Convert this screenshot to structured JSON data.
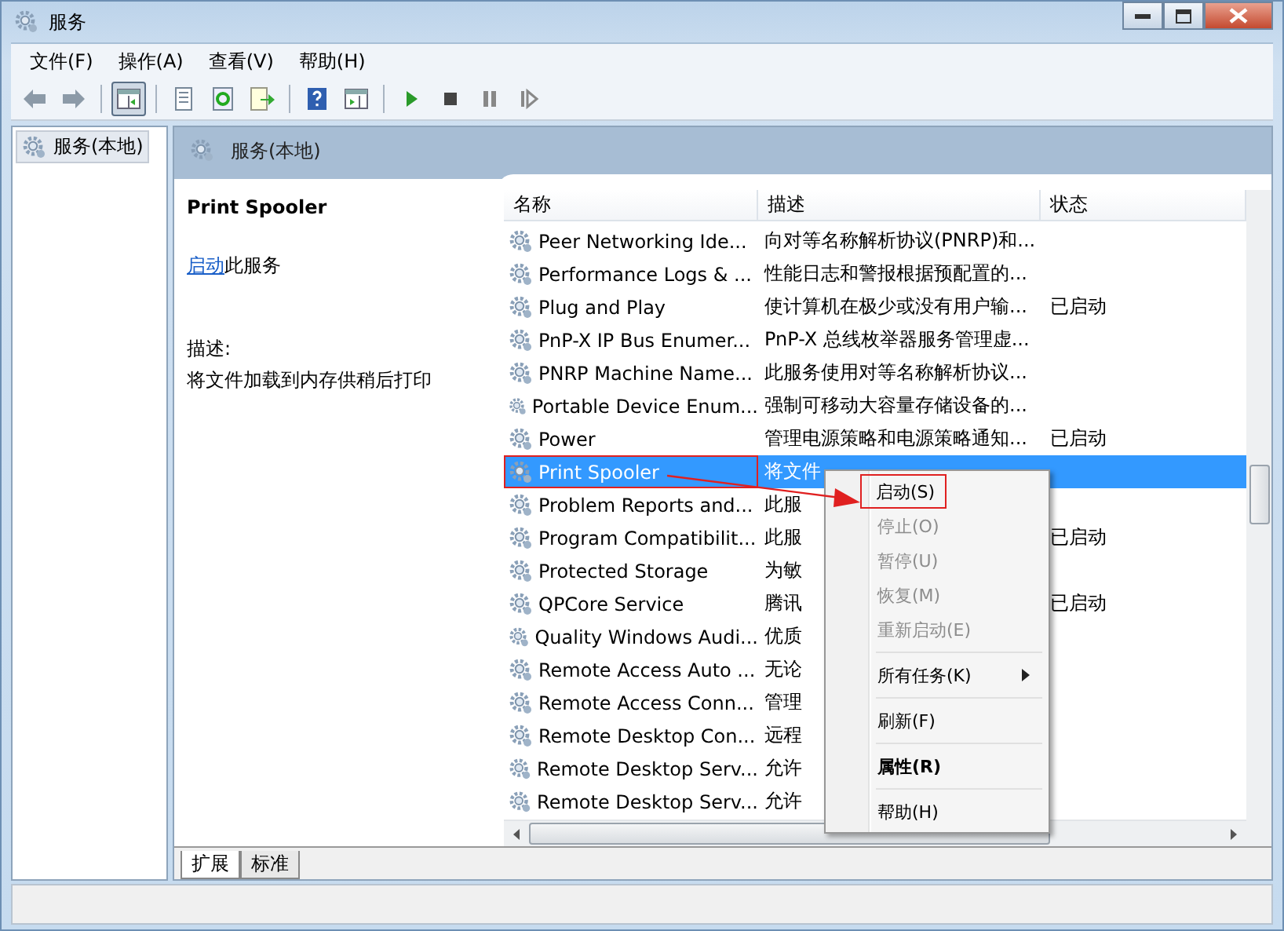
{
  "window": {
    "title": "服务"
  },
  "menu_bar": [
    "文件(F)",
    "操作(A)",
    "查看(V)",
    "帮助(H)"
  ],
  "toolbar_groups": [
    [
      {
        "kind": "back",
        "pressed": false
      },
      {
        "kind": "forward",
        "pressed": false
      }
    ],
    [
      {
        "kind": "tree",
        "pressed": true
      }
    ],
    [
      {
        "kind": "properties",
        "pressed": false
      },
      {
        "kind": "refresh",
        "pressed": false
      },
      {
        "kind": "export",
        "pressed": false
      }
    ],
    [
      {
        "kind": "help",
        "pressed": false
      },
      {
        "kind": "pane",
        "pressed": false
      }
    ],
    [
      {
        "kind": "play",
        "pressed": false
      },
      {
        "kind": "stop",
        "pressed": false
      },
      {
        "kind": "pause",
        "pressed": false
      },
      {
        "kind": "resume",
        "pressed": false
      }
    ]
  ],
  "tree": [
    {
      "label": "服务(本地)",
      "selected": true
    }
  ],
  "pane_header": "服务(本地)",
  "details": {
    "title": "Print Spooler",
    "action_link": "启动",
    "action_text": "此服务",
    "description_label": "描述:",
    "description": "将文件加载到内存供稍后打印"
  },
  "table": {
    "columns": [
      "名称",
      "描述",
      "状态"
    ],
    "rows": [
      {
        "name": "Peer Networking Ide...",
        "description": "向对等名称解析协议(PNRP)和...",
        "status": "",
        "selected": false,
        "highlighted": false
      },
      {
        "name": "Performance Logs & ...",
        "description": "性能日志和警报根据预配置的...",
        "status": "",
        "selected": false,
        "highlighted": false
      },
      {
        "name": "Plug and Play",
        "description": "使计算机在极少或没有用户输...",
        "status": "已启动",
        "selected": false,
        "highlighted": false
      },
      {
        "name": "PnP-X IP Bus Enumer...",
        "description": "PnP-X 总线枚举器服务管理虚...",
        "status": "",
        "selected": false,
        "highlighted": false
      },
      {
        "name": "PNRP Machine Name...",
        "description": "此服务使用对等名称解析协议...",
        "status": "",
        "selected": false,
        "highlighted": false
      },
      {
        "name": "Portable Device Enum...",
        "description": "强制可移动大容量存储设备的...",
        "status": "",
        "selected": false,
        "highlighted": false
      },
      {
        "name": "Power",
        "description": "管理电源策略和电源策略通知...",
        "status": "已启动",
        "selected": false,
        "highlighted": false
      },
      {
        "name": "Print Spooler",
        "description": "将文件",
        "status": "",
        "selected": true,
        "highlighted": true
      },
      {
        "name": "Problem Reports and...",
        "description": "此服",
        "status": "",
        "selected": false,
        "highlighted": false
      },
      {
        "name": "Program Compatibilit...",
        "description": "此服",
        "status": "已启动",
        "selected": false,
        "highlighted": false
      },
      {
        "name": "Protected Storage",
        "description": "为敏",
        "status": "",
        "selected": false,
        "highlighted": false
      },
      {
        "name": "QPCore Service",
        "description": "腾讯",
        "status": "已启动",
        "selected": false,
        "highlighted": false
      },
      {
        "name": "Quality Windows Audi...",
        "description": "优质",
        "status": "",
        "selected": false,
        "highlighted": false
      },
      {
        "name": "Remote Access Auto ...",
        "description": "无论",
        "status": "",
        "selected": false,
        "highlighted": false
      },
      {
        "name": "Remote Access Conn...",
        "description": "管理",
        "status": "",
        "selected": false,
        "highlighted": false
      },
      {
        "name": "Remote Desktop Con...",
        "description": "远程",
        "status": "",
        "selected": false,
        "highlighted": false
      },
      {
        "name": "Remote Desktop Serv...",
        "description": "允许",
        "status": "",
        "selected": false,
        "highlighted": false
      },
      {
        "name": "Remote Desktop Serv...",
        "description": "允许",
        "status": "",
        "selected": false,
        "highlighted": false
      }
    ]
  },
  "context_menu": [
    {
      "kind": "item",
      "label": "启动(S)",
      "disabled": false,
      "bold": false,
      "highlighted": true
    },
    {
      "kind": "item",
      "label": "停止(O)",
      "disabled": true,
      "bold": false,
      "highlighted": false
    },
    {
      "kind": "item",
      "label": "暂停(U)",
      "disabled": true,
      "bold": false,
      "highlighted": false
    },
    {
      "kind": "item",
      "label": "恢复(M)",
      "disabled": true,
      "bold": false,
      "highlighted": false
    },
    {
      "kind": "item",
      "label": "重新启动(E)",
      "disabled": true,
      "bold": false,
      "highlighted": false
    },
    {
      "kind": "separator"
    },
    {
      "kind": "submenu",
      "label": "所有任务(K)",
      "disabled": false,
      "bold": false,
      "highlighted": false
    },
    {
      "kind": "separator"
    },
    {
      "kind": "item",
      "label": "刷新(F)",
      "disabled": false,
      "bold": false,
      "highlighted": false
    },
    {
      "kind": "separator"
    },
    {
      "kind": "item",
      "label": "属性(R)",
      "disabled": false,
      "bold": true,
      "highlighted": false
    },
    {
      "kind": "separator"
    },
    {
      "kind": "item",
      "label": "帮助(H)",
      "disabled": false,
      "bold": false,
      "highlighted": false
    }
  ],
  "bottom_tabs": [
    {
      "label": "扩展",
      "selected": true
    },
    {
      "label": "标准",
      "selected": false
    }
  ]
}
